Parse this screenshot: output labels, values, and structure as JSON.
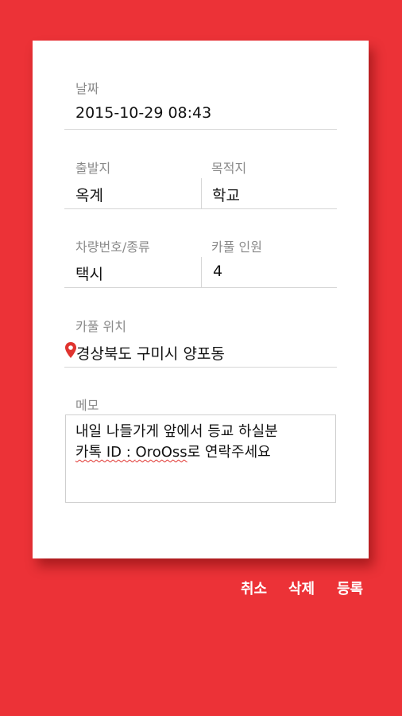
{
  "form": {
    "date": {
      "label": "날짜",
      "value": "2015-10-29 08:43"
    },
    "departure": {
      "label": "출발지",
      "value": "옥계"
    },
    "destination": {
      "label": "목적지",
      "value": "학교"
    },
    "vehicle": {
      "label": "차량번호/종류",
      "value": "택시"
    },
    "carpool_count": {
      "label": "카풀 인원",
      "value": "4"
    },
    "location": {
      "label": "카풀 위치",
      "value": "경상북도 구미시 양포동",
      "icon": "location-pin-icon"
    },
    "memo": {
      "label": "메모",
      "line1": "내일 나들가게 앞에서 등교 하실분",
      "line2_prefix": "카톡 ID : ",
      "line2_id": "OroOss",
      "line2_suffix": "로 연락주세요"
    }
  },
  "actions": {
    "cancel": "취소",
    "delete": "삭제",
    "register": "등록"
  },
  "colors": {
    "background": "#ec3237",
    "card": "#ffffff",
    "pin": "#e0342f"
  }
}
